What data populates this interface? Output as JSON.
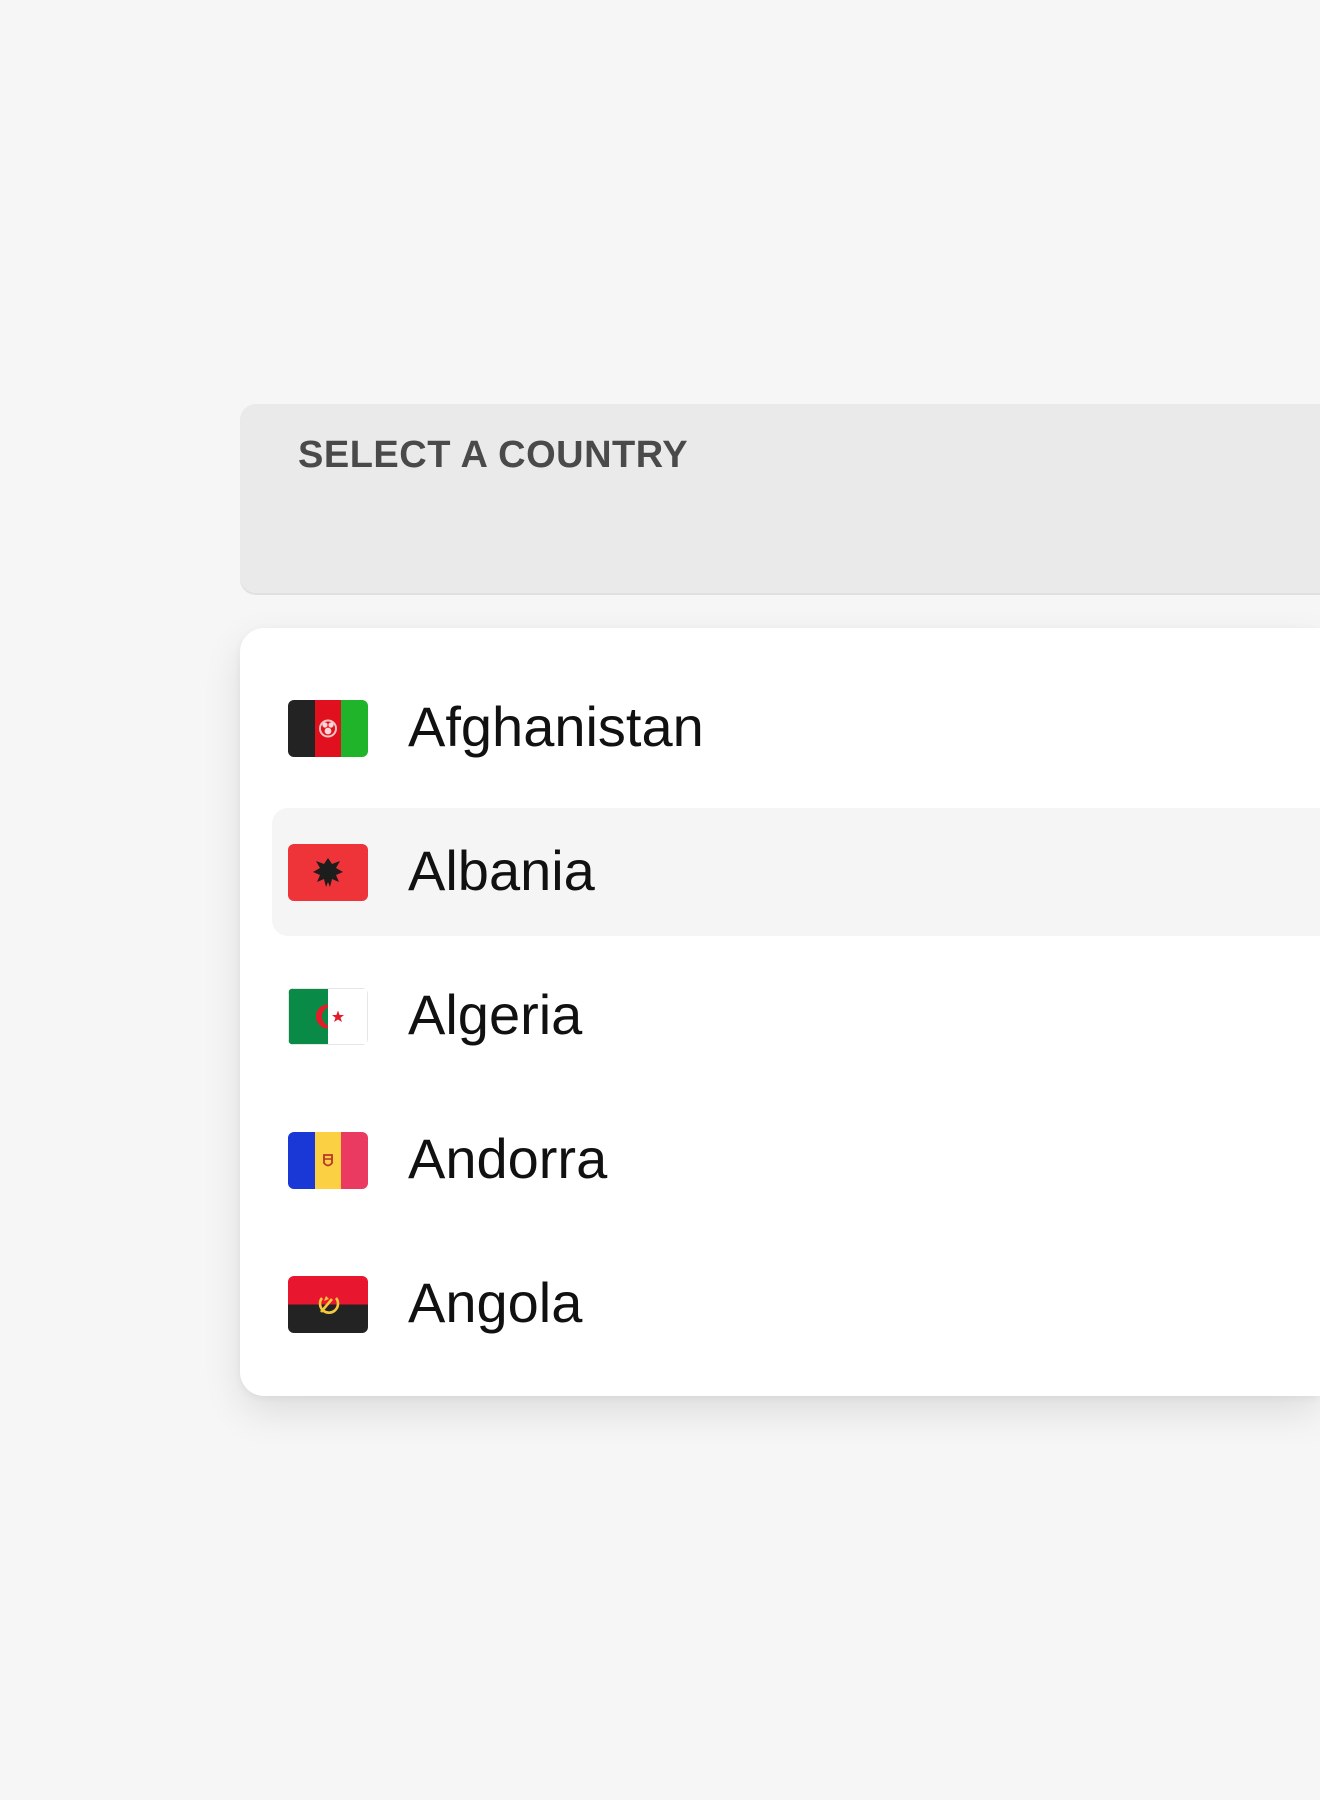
{
  "select": {
    "label": "SELECT A COUNTRY"
  },
  "options": [
    {
      "label": "Afghanistan",
      "icon": "afghanistan-flag-icon"
    },
    {
      "label": "Albania",
      "icon": "albania-flag-icon",
      "highlighted": true
    },
    {
      "label": "Algeria",
      "icon": "algeria-flag-icon"
    },
    {
      "label": "Andorra",
      "icon": "andorra-flag-icon"
    },
    {
      "label": "Angola",
      "icon": "angola-flag-icon"
    }
  ],
  "colors": {
    "background": "#f6f6f6",
    "field": "#eaeaea",
    "dropdown": "#ffffff",
    "highlight": "#f5f5f5",
    "label": "#4a4a4a",
    "text": "#111111"
  }
}
